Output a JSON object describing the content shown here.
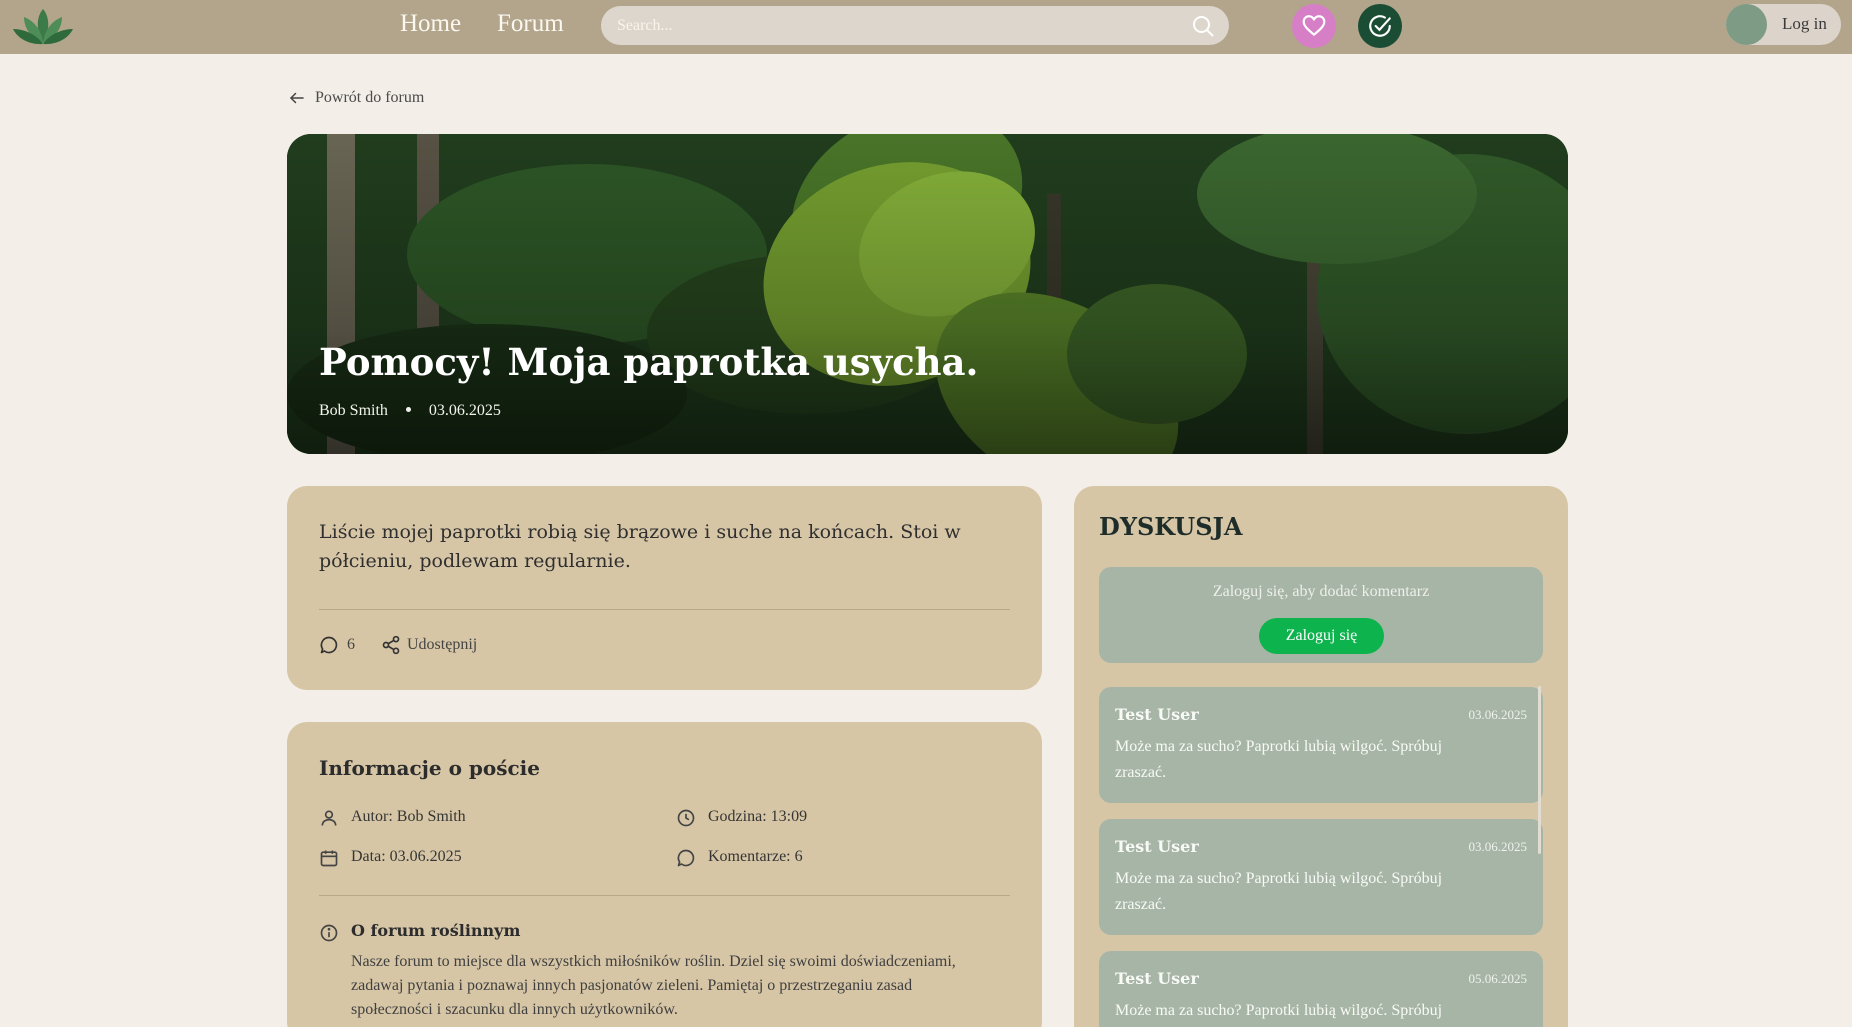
{
  "nav": {
    "home": "Home",
    "forum": "Forum",
    "search_placeholder": "Search...",
    "login": "Log in"
  },
  "back_link": "Powrót do forum",
  "post": {
    "title": "Pomocy! Moja paprotka usycha.",
    "author": "Bob Smith",
    "date": "03.06.2025",
    "body": "Liście mojej paprotki robią się brązowe i suche na końcach. Stoi w półcieniu, podlewam regularnie.",
    "comment_count": "6",
    "share_label": "Udostępnij"
  },
  "info": {
    "title": "Informacje o poście",
    "author": "Autor: Bob Smith",
    "time": "Godzina: 13:09",
    "date": "Data: 03.06.2025",
    "comments": "Komentarze: 6",
    "about_title": "O forum roślinnym",
    "about_text": "Nasze forum to miejsce dla wszystkich miłośników roślin. Dziel się swoimi doświadczeniami, zadawaj pytania i poznawaj innych pasjonatów zieleni. Pamiętaj o przestrzeganiu zasad społeczności i szacunku dla innych użytkowników."
  },
  "discussion": {
    "title": "DYSKUSJA",
    "login_prompt": "Zaloguj się, aby dodać komentarz",
    "login_button": "Zaloguj się",
    "comments": [
      {
        "author": "Test User",
        "date": "03.06.2025",
        "text": "Może ma za sucho? Paprotki lubią wilgoć. Spróbuj zraszać."
      },
      {
        "author": "Test User",
        "date": "03.06.2025",
        "text": "Może ma za sucho? Paprotki lubią wilgoć. Spróbuj zraszać."
      },
      {
        "author": "Test User",
        "date": "05.06.2025",
        "text": "Może ma za sucho? Paprotki lubią wilgoć. Spróbuj zraszać."
      }
    ]
  },
  "colors": {
    "nav_bg": "#b2a58b",
    "page_bg": "#f3efe8",
    "card_bg": "#d6c6a6",
    "comment_bg": "#a7b5a6",
    "login_button": "#0db34d",
    "favorites_button": "#d77fc6",
    "tasks_button": "#1b4d35"
  },
  "icons": [
    "lotus-logo-icon",
    "search-icon",
    "heart-icon",
    "check-circle-icon",
    "arrow-left-icon",
    "comment-icon",
    "share-icon",
    "user-icon",
    "clock-icon",
    "calendar-icon",
    "info-icon"
  ]
}
